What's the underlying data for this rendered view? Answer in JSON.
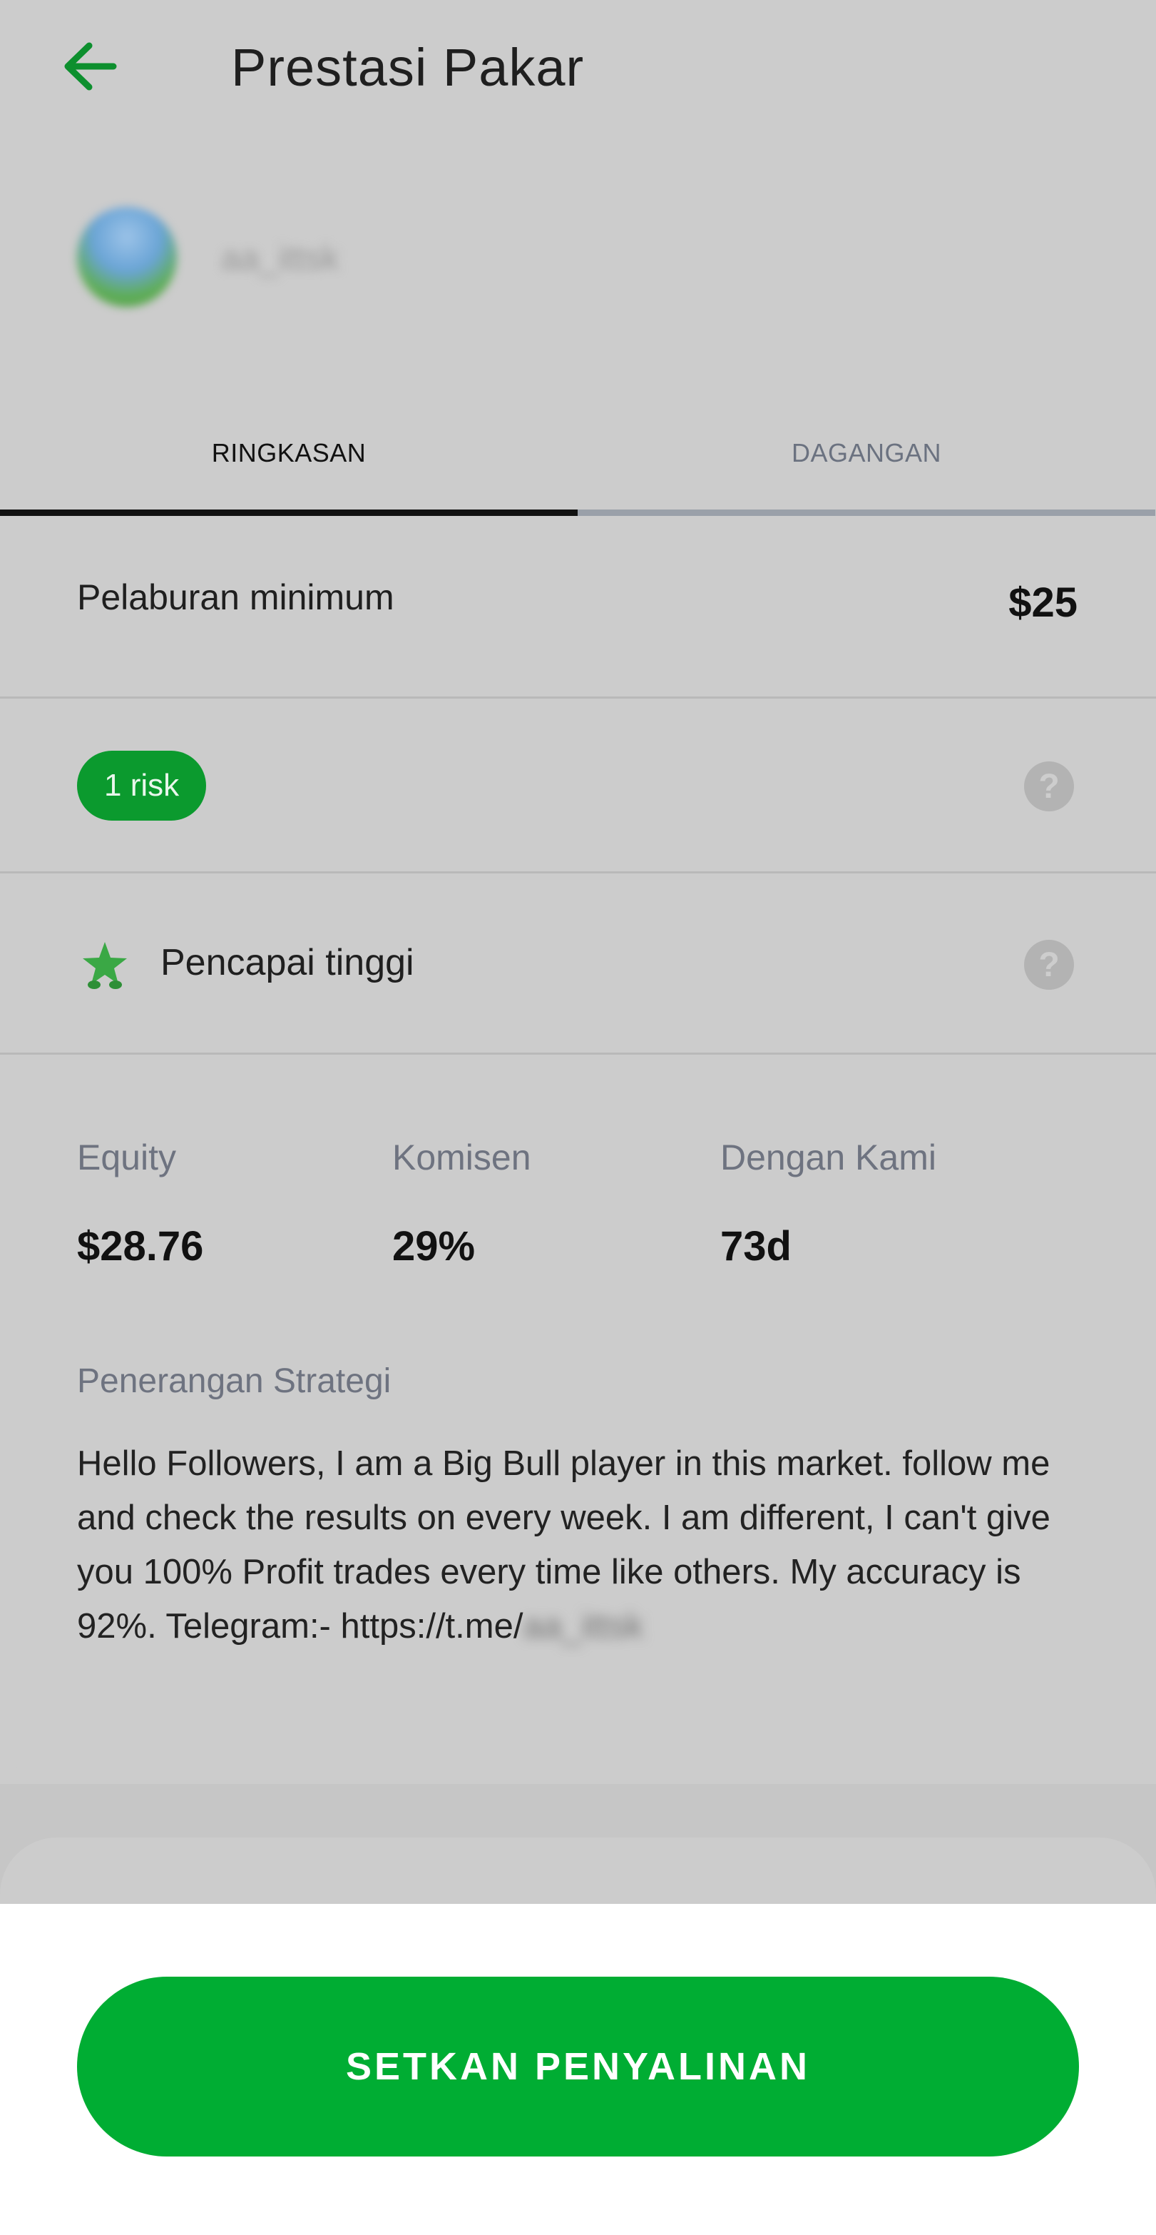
{
  "header": {
    "title": "Prestasi Pakar",
    "back_icon": "arrow-left-icon"
  },
  "profile": {
    "username": "aa_ittsk"
  },
  "tabs": [
    {
      "label": "RINGKASAN",
      "active": true
    },
    {
      "label": "DAGANGAN",
      "active": false
    }
  ],
  "minimum_investment": {
    "label": "Pelaburan minimum",
    "value": "$25"
  },
  "risk": {
    "badge": "1 risk",
    "help_icon": "question-circle-icon"
  },
  "achievement": {
    "label": "Pencapai tinggi",
    "icon": "star-achiever-icon",
    "help_icon": "question-circle-icon"
  },
  "stats": [
    {
      "label": "Equity",
      "value": "$28.76"
    },
    {
      "label": "Komisen",
      "value": "29%"
    },
    {
      "label": "Dengan Kami",
      "value": "73d"
    }
  ],
  "strategy": {
    "label": "Penerangan Strategi",
    "text": "Hello Followers, I am a Big Bull player in this market. follow me and check the results on every week. I am different, I can't give you 100% Profit trades every time like others. My accuracy is 92%. Telegram:- https://t.me/",
    "text_hidden_tail": "aa_ittsk"
  },
  "cta": {
    "label": "SETKAN PENYALINAN"
  },
  "colors": {
    "accent": "#00ad33",
    "badge": "#0b9a2e",
    "back_arrow": "#0d8f2e"
  }
}
